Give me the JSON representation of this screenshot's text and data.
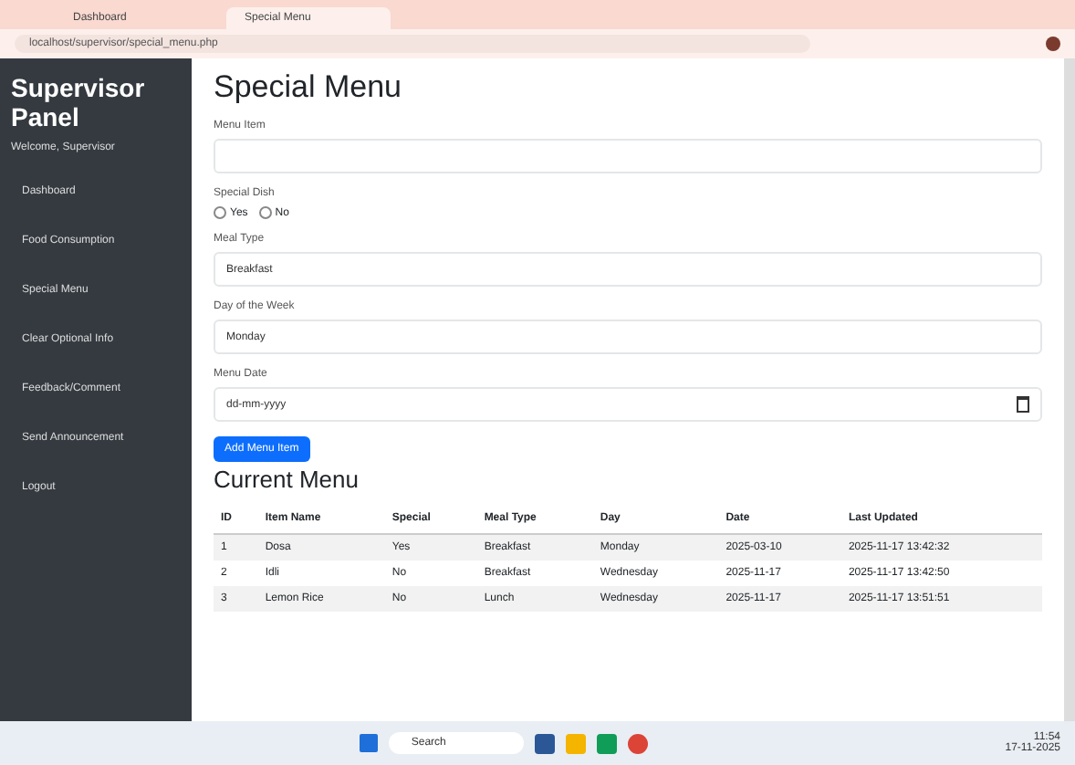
{
  "browser": {
    "tabs": [
      {
        "label": "Dashboard",
        "selected": false
      },
      {
        "label": "Special Menu",
        "selected": true
      }
    ],
    "address": "localhost/supervisor/special_menu.php"
  },
  "sidebar": {
    "title": "Supervisor Panel",
    "welcome": "Welcome, Supervisor",
    "items": [
      {
        "label": "Dashboard",
        "selected": false
      },
      {
        "label": "Food Consumption",
        "selected": false
      },
      {
        "label": "Special Menu",
        "selected": false
      },
      {
        "label": "Clear Optional Info",
        "selected": false
      },
      {
        "label": "Feedback/Comment",
        "selected": false
      },
      {
        "label": "Send Announcement",
        "selected": false
      },
      {
        "label": "Logout",
        "selected": false
      }
    ]
  },
  "form": {
    "title": "Special Menu",
    "fields": [
      {
        "kind": "text",
        "label": "Menu Item"
      },
      {
        "kind": "radio",
        "label": "Special Dish",
        "options": [
          {
            "label": "Yes",
            "selected": false
          },
          {
            "label": "No",
            "selected": false
          }
        ]
      },
      {
        "kind": "select",
        "label": "Meal Type",
        "value": "Breakfast"
      },
      {
        "kind": "select",
        "label": "Day of the Week",
        "value": "Monday"
      },
      {
        "kind": "date",
        "label": "Menu Date",
        "placeholder": "dd-mm-yyyy"
      }
    ],
    "button": "Add Menu Item"
  },
  "table": {
    "title": "Current Menu",
    "columns": [
      "ID",
      "Item Name",
      "Special",
      "Meal Type",
      "Day",
      "Date",
      "Last Updated"
    ],
    "rows": [
      [
        "1",
        "Dosa",
        "Yes",
        "Breakfast",
        "Monday",
        "2025-03-10",
        "2025-11-17 13:42:32"
      ],
      [
        "2",
        "Idli",
        "No",
        "Breakfast",
        "Wednesday",
        "2025-11-17",
        "2025-11-17 13:42:50"
      ],
      [
        "3",
        "Lemon Rice",
        "No",
        "Lunch",
        "Wednesday",
        "2025-11-17",
        "2025-11-17 13:51:51"
      ]
    ]
  },
  "taskbar": {
    "search": "Search",
    "time": "11:54",
    "date": "17-11-2025"
  }
}
